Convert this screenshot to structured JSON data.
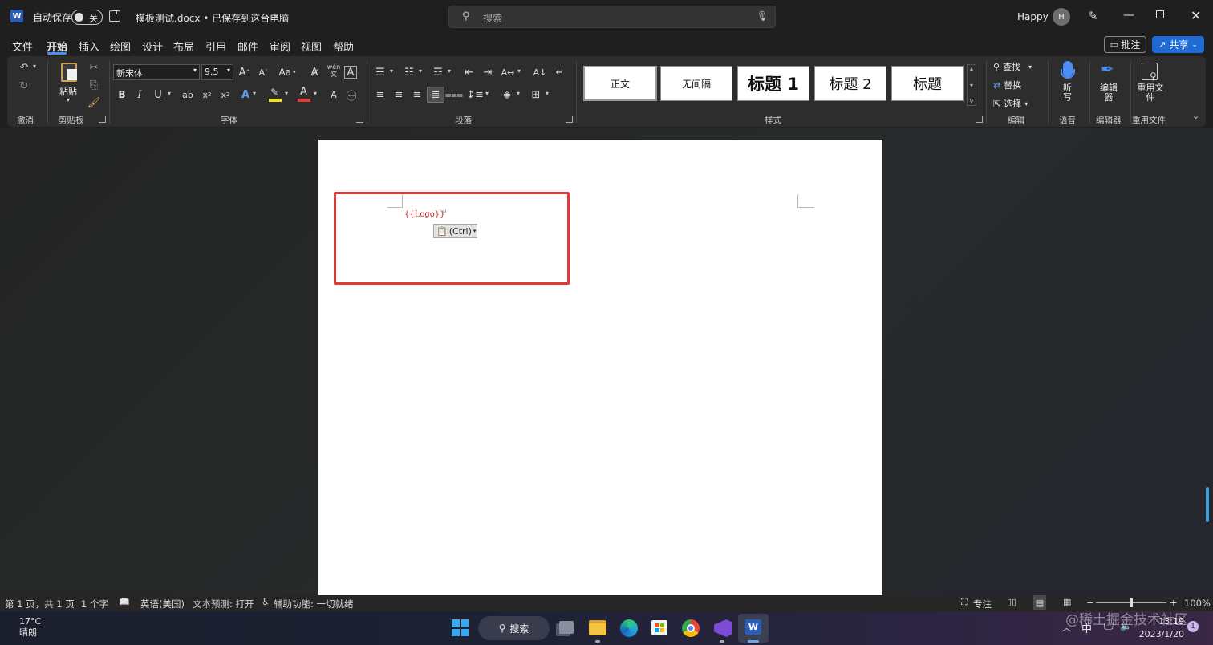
{
  "titlebar": {
    "app_icon": "word-icon",
    "autosave_label": "自动保存",
    "autosave_state": "关",
    "save_icon": "save-icon",
    "doc_title": "模板测试.docx • 已保存到这台电脑",
    "search_placeholder": "搜索",
    "user_name": "Happy",
    "avatar_initial": "H"
  },
  "menu": {
    "items": [
      "文件",
      "开始",
      "插入",
      "绘图",
      "设计",
      "布局",
      "引用",
      "邮件",
      "审阅",
      "视图",
      "帮助"
    ],
    "active": "开始",
    "comment_label": "批注",
    "share_label": "共享"
  },
  "ribbon": {
    "undo_group": "撤消",
    "clipboard": {
      "paste_label": "粘贴",
      "group": "剪贴板"
    },
    "font": {
      "font_name": "新宋体",
      "font_size": "9.5",
      "group": "字体",
      "change_case": "Aa",
      "wen": "wén"
    },
    "paragraph": {
      "group": "段落"
    },
    "styles": {
      "cards": [
        "正文",
        "无间隔",
        "标题 1",
        "标题 2",
        "标题"
      ],
      "group": "样式"
    },
    "editing": {
      "find": "查找",
      "replace": "替换",
      "select": "选择",
      "group": "编辑"
    },
    "voice": {
      "label": "听写",
      "group": "语音"
    },
    "editor": {
      "label": "编辑器",
      "group": "编辑器"
    },
    "reuse": {
      "label": "重用文件",
      "group": "重用文件"
    }
  },
  "document": {
    "field_text": "{{Logo}}",
    "paste_options": "(Ctrl)",
    "highlight_color": "#e53935"
  },
  "statusbar": {
    "page": "第 1 页，共 1 页",
    "words": "1 个字",
    "language": "英语(美国)",
    "text_predict": "文本预测: 打开",
    "accessibility": "辅助功能: 一切就绪",
    "focus": "专注",
    "zoom": "100%"
  },
  "taskbar": {
    "weather_temp": "17°C",
    "weather_desc": "晴朗",
    "search_label": "搜索",
    "ime": "中",
    "time": "13:19",
    "date": "2023/1/20",
    "notification_count": "1",
    "watermark": "@稀土掘金技术社区"
  },
  "colors": {
    "accent": "#4a8ef5",
    "share_bg": "#1f6bd6",
    "word_blue": "#2b5db8"
  }
}
